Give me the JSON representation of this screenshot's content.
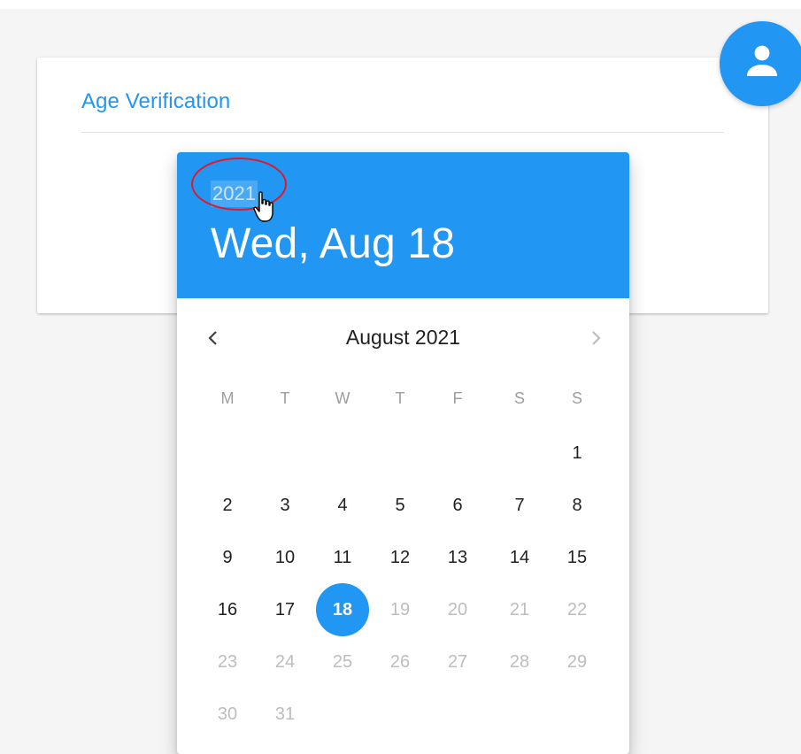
{
  "card": {
    "title": "Age Verification"
  },
  "fab": {
    "icon": "person-icon",
    "color": "#2196f3"
  },
  "picker": {
    "header_color": "#2196f3",
    "year": "2021",
    "selected_date_label": "Wed, Aug 18",
    "month_label": "August 2021",
    "prev_icon": "chevron-left-icon",
    "next_icon": "chevron-right-icon",
    "weekdays": [
      "M",
      "T",
      "W",
      "T",
      "F",
      "S",
      "S"
    ],
    "selected_day": "18",
    "weeks": [
      [
        "",
        "",
        "",
        "",
        "",
        "",
        "1"
      ],
      [
        "2",
        "3",
        "4",
        "5",
        "6",
        "7",
        "8"
      ],
      [
        "9",
        "10",
        "11",
        "12",
        "13",
        "14",
        "15"
      ],
      [
        "16",
        "17",
        "18",
        "19",
        "20",
        "21",
        "22"
      ],
      [
        "23",
        "24",
        "25",
        "26",
        "27",
        "28",
        "29"
      ],
      [
        "30",
        "31",
        "",
        "",
        "",
        "",
        ""
      ]
    ],
    "disabled_days": [
      "19",
      "20",
      "21",
      "22",
      "23",
      "24",
      "25",
      "26",
      "27",
      "28",
      "29",
      "30",
      "31"
    ]
  }
}
